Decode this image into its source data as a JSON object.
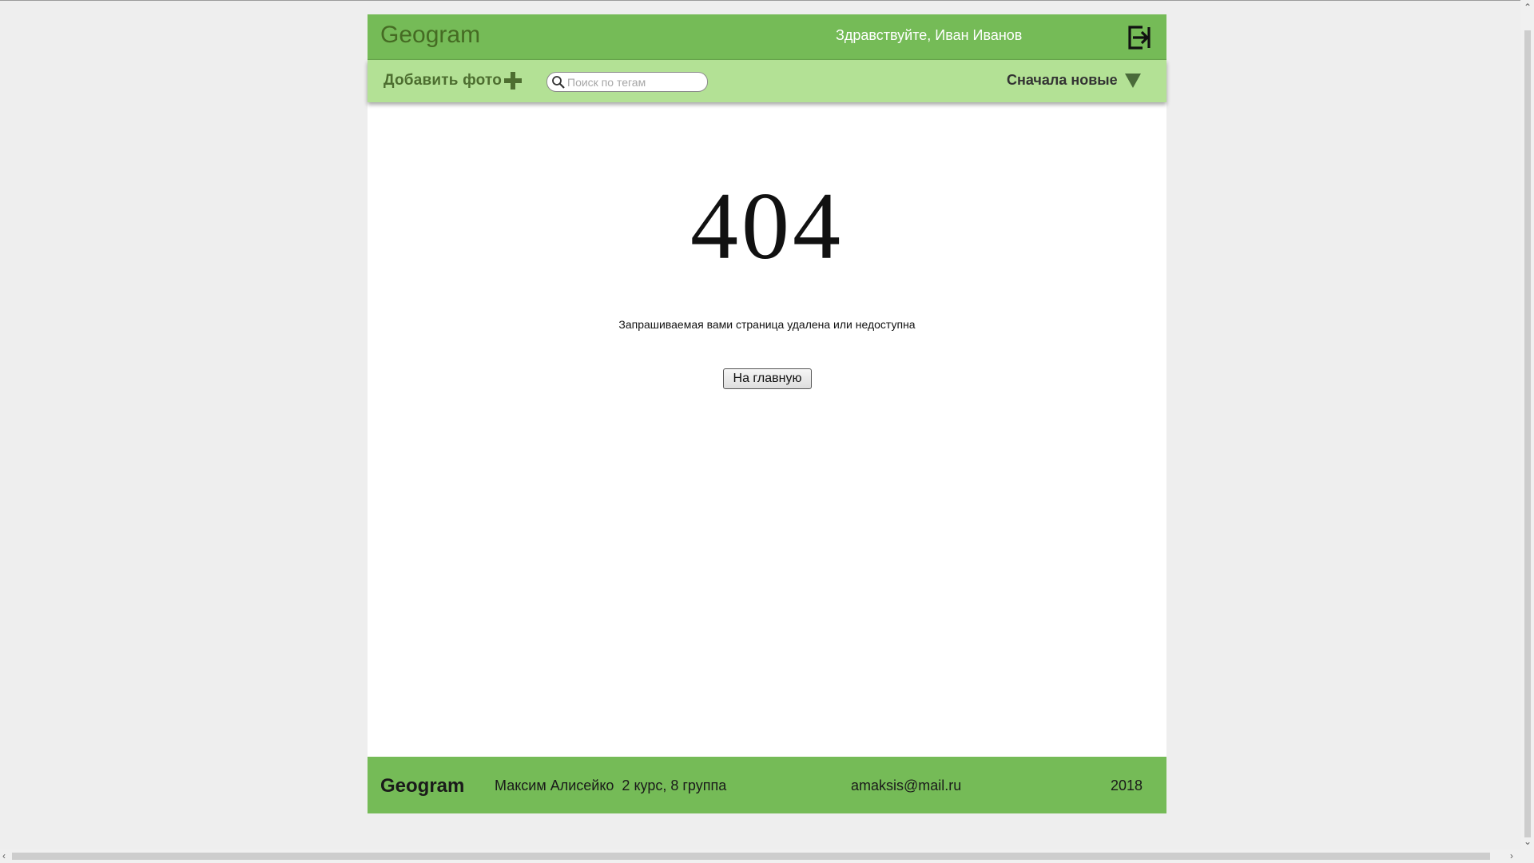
{
  "header": {
    "logo": "Geogram",
    "greeting": "Здравствуйте, Иван Иванов",
    "logout_icon": "logout-arrow-icon"
  },
  "toolbar": {
    "add_photo_label": "Добавить фото",
    "add_photo_icon": "plus-icon",
    "search": {
      "placeholder": "Поиск по тегам",
      "value": "",
      "icon": "search-icon"
    },
    "sort_label": "Сначала новые",
    "sort_icon": "triangle-down-icon"
  },
  "main": {
    "error_code": "404",
    "error_message": "Запрашиваемая вами страница удалена или недоступна",
    "home_button_label": "На главную"
  },
  "footer": {
    "logo": "Geogram",
    "author": "Максим Алисейко  2 курс, 8 группа",
    "email": "amaksis@mail.ru",
    "year": "2018"
  },
  "colors": {
    "header_green": "#75bb57",
    "toolbar_green": "#b3e195",
    "logo_green": "#456b23",
    "page_background": "#eeeeee"
  }
}
